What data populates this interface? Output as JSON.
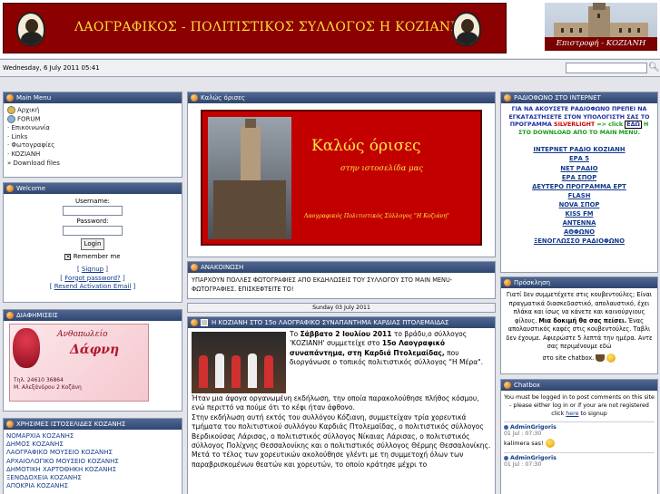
{
  "header": {
    "title": "ΛΑΟΓΡΑΦΙΚΟΣ -  ΠΟΛΙΤΙΣΤΙΚΟΣ ΣΥΛΛΟΓΟΣ    Η ΚΟΖΙΑΝΗ",
    "back_link": "Επιστροφή - ΚΟΖΙΑΝΗ"
  },
  "datebar": {
    "date": "Wednesday, 6 July 2011 05:41",
    "search_placeholder": ""
  },
  "main_menu": {
    "title": "Main Menu",
    "items": [
      "Αρχική",
      "FORUM",
      "Επικοινωνία",
      "Links",
      "Φωτογραφίες",
      "KOZIANH",
      "Download files"
    ]
  },
  "welcome": {
    "title": "Welcome",
    "username_label": "Username:",
    "password_label": "Password:",
    "login_button": "Login",
    "remember_me": "Remember me",
    "signup": "Signup",
    "forgot_password": "Forgot password?",
    "resend": "Resend Activation Email"
  },
  "ads": {
    "title": "ΔΙΑΦΗΜΙΣΕΙΣ",
    "shop_word": "Ανθοπωλείο",
    "shop_name": "Δάφνη",
    "phone": "Τηλ. 24610 36864",
    "address": "Μ. Αλεξάνδρου 2 Κοζάνη"
  },
  "sites": {
    "title": "ΧΡΗΣΙΜΕΣ ΙΣΤΟΣΕΛΙΔΕΣ ΚΟΖΑΝΗΣ",
    "items": [
      "ΝΟΜΑΡΧΙΑ ΚΟΖΑΝΗΣ",
      "ΔΗΜΟΣ ΚΟΖΑΝΗΣ",
      "ΛΑΟΓΡΑΦΙΚΟ ΜΟΥΣΕΙΟ ΚΟΖΑΝΗΣ",
      "ΑΡΧΑΙΟΛΟΓΙΚΟ ΜΟΥΣΕΙΟ ΚΟΖΑΝΗΣ",
      "ΔΗΜΟΤΙΚΗ ΧΑΡΤΟΘΗΚΗ ΚΟΖΑΝΗΣ",
      "ΞΕΝΟΔΟΧΕΙΑ ΚΟΖΑΝΗΣ",
      "ΑΠΟΚΡΙΑ ΚΟΖΑΝΗΣ"
    ]
  },
  "welcome_panel": {
    "title": "Καλώς όρισες",
    "banner_title": "Καλώς όρισες",
    "banner_subtitle": "στην ιστοσελίδα μας",
    "banner_org": "Λαογραφικός Πολιτιστικός Σύλλογος \"Η Κοζιάνη\""
  },
  "announcement": {
    "title": "ΑΝΑΚΟΙΝΩΣΗ",
    "text": "ΥΠΑΡΧΟΥΝ ΠΟΛΛΕΣ ΦΩΤΟΓΡΑΦΙΕΣ ΑΠΟ ΕΚΔΗΛΩΣΕΙΣ ΤΟΥ ΣΥΛΛΟΓΟΥ ΣΤΟ ΜΑΙΝ ΜΕΝU-ΦΩΤΟΓΡΑΦΙΕΣ. ΕΠΙΣΚΕΦΤΕΙΤΕ ΤΟ!"
  },
  "date_separator": "Sunday 03 July 2011",
  "article": {
    "title": "Η ΚΟΖΙΑΝΗ ΣΤΟ 15ο ΛΑΟΓΡΑΦΙΚΟ ΣΥΝΑΠΑΝΤΗΜΑ ΚΑΡΔΙΑΣ ΠΤΟΛΕΜΑΙΔΑΣ",
    "p_to": "Το ",
    "p_date": "Σάββατο 2 Ιουλίου 2011",
    "p_mid": " το βράδυ,ο σύλλογος 'ΚΟΖΙΑΝΗ' συμμετείχε στο ",
    "p_event": "15ο Λαογραφικό συναπάντημα, στη Καρδιά Πτολεμαίδας,",
    "p_end": " που διοργάνωσε ο τοπικός πολιτιστικός σύλλογος \"Η Μέρα\".",
    "p2": "Ήταν μια άψογα οργανωμένη εκδήλωση, την οποία παρακολούθησε πλήθος κόσμου, ενώ περιττό να πούμε ότι το κέφι ήταν άφθονο.",
    "p3": "Στην εκδήλωση αυτή εκτός του συλλόγου Κόζιανη, συμμετείχαν τρία χορευτικά τμήματα του πολιτιστικού συλλόγου Καρδιάς Πτολεμαϊδας, ο πολιτιστικός σύλλογος Βερδικούσας Λάρισας, ο πολιτιστικός σύλλογος Νίκαιας Λάρισας, ο πολιτιστικός σύλλογος Πολίχνης Θεσσαλονίκης και ο πολιτιστικός σύλλογος Θέρμης Θεσσαλονίκης.",
    "p4": "Μετά το τέλος των χορευτικών ακολούθησε γλέντι με τη συμμετοχή όλων των παραβρισκομένων θεατών και χορευτών, το οποίο κράτησε μέχρι το"
  },
  "radio": {
    "title": "ΡΑΔΙΟΦΩΝΟ ΣΤΟ ΙΝΤΕΡΝΕΤ",
    "notice_a": "ΓΙΑ ΝΑ ΑΚΟΥΣΕΤΕ ΡΑΔΙΟΦΩΝΟ ΠΡΕΠΕΙ ΝΑ ΕΓΚΑΤΑΣΤΗΣΕΤΕ ΣΤΟΝ ΥΠΟΛΟΓΙΣΤΗ ΣΑΣ ΤΟ ΠΡΟΓΡΑΜΜΑ ",
    "notice_silverlight": "SILVERLIGHT",
    "notice_arrow": " => click ",
    "notice_here": "ΕΔΩ",
    "notice_b": " Η ΣΤΟ DOWNLOAD",
    "notice_c": "ΑΠΟ ΤΟ MAIN MENU.",
    "stations": [
      "ΙΝΤΕΡΝΕΤ ΡΑΔΙΟ ΚΟΖΙΑΝΗ",
      "ΕΡΑ 5",
      "ΝΕΤ ΡΑΔΙΟ",
      "ΕΡΑ ΣΠΟΡ",
      "ΔΕΥΤΕΡΟ ΠΡΟΓΡΑΜΜΑ ΕΡΤ",
      "FLASH",
      "NOVA ΣΠΟΡ",
      "KISS FM",
      "ANTENNA",
      "ΑΘΦΩΝΟ",
      "ΞΕΝΟΓΛΩΣΣΟ ΡΑΔΙΟΦΩΝΟ"
    ]
  },
  "invitation": {
    "title": "Πρόσκληση",
    "text_a": "Γιατί δεν συμμετέχετε στις κουβεντούλες; Είναι πραγματικά διασκεδαστικό, απολαυστικό, έχει πλάκα και ίσως να κάνετε και καινούργιους φίλους. ",
    "text_bold": "Μια δοκιμή θα σας πείσει.",
    "text_b": " Ένας απολαυστικός καφές στις κουβεντούλες. Ταβλι δεν έχουμε. Αφιερώστε 5 λεπτά την ημέρα. Αντε σας περιμένουμε εδώ",
    "text_c": "στο site chatbox."
  },
  "chatbox": {
    "title": "Chatbox",
    "notice": "You must be logged in to post comments on this site - please either log in or if your are not registered click ",
    "notice_link": "here",
    "notice_end": " to signup",
    "messages": [
      {
        "author": "AdminGrigoris",
        "time": "01 Jul : 07:30",
        "text": "kalimera sas!"
      },
      {
        "author": "AdminGrigoris",
        "time": "01 Jul : 07:30",
        "text": ""
      }
    ]
  },
  "colors": {
    "banner_red": "#8b0000",
    "title_yellow": "#ffde3a",
    "panel_header": "#2f4670",
    "link_blue": "#123a8a"
  }
}
